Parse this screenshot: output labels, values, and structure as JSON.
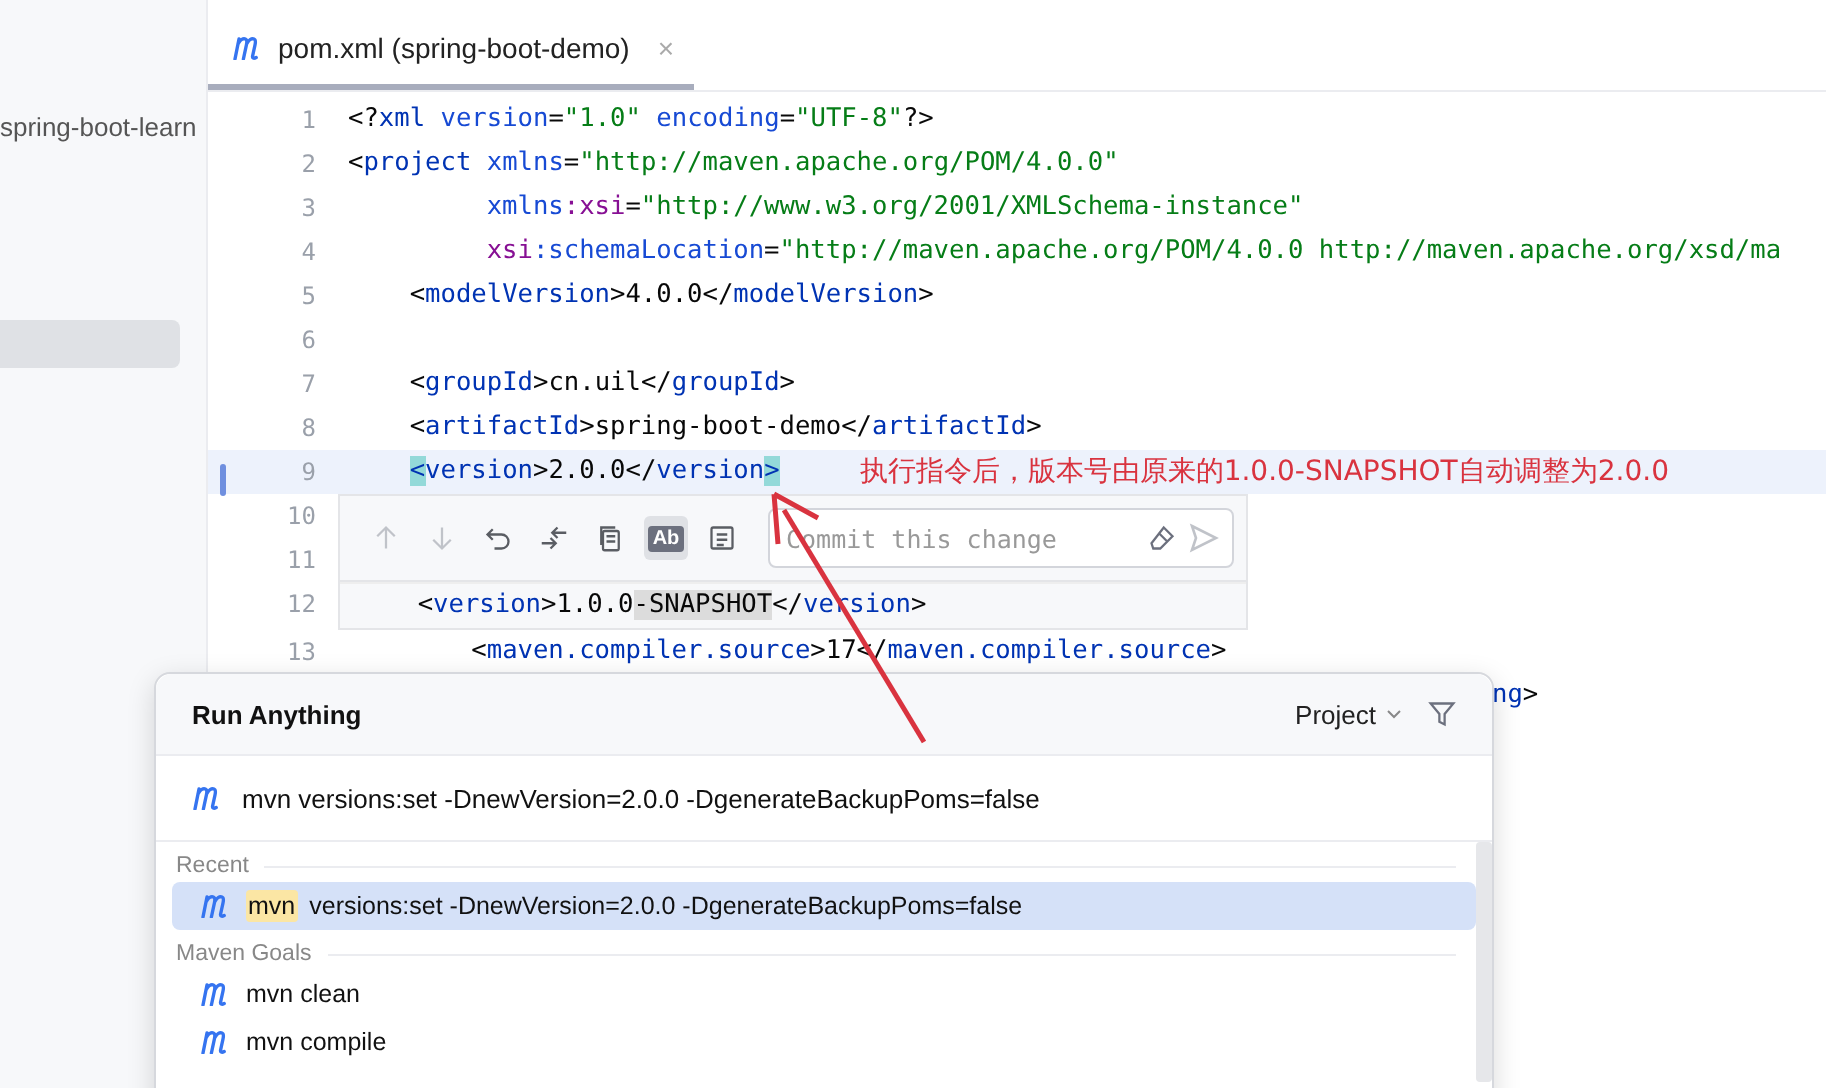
{
  "sidebar": {
    "items": [
      {
        "label": "spring-boot-learn",
        "selected": false
      },
      {
        "selected": true
      }
    ]
  },
  "editor": {
    "tab": {
      "label": "pom.xml (spring-boot-demo)",
      "close": "×",
      "selected": true
    },
    "lines": [
      {
        "kind": "code",
        "number": "1",
        "current": false,
        "changed": false,
        "tokens": [
          {
            "text": "<?",
            "kind": "p"
          },
          {
            "text": "xml",
            "kind": "tag"
          },
          {
            "text": " version",
            "kind": "attr"
          },
          {
            "text": "=",
            "kind": "p"
          },
          {
            "text": "\"1.0\"",
            "kind": "str"
          },
          {
            "text": " encoding",
            "kind": "attr"
          },
          {
            "text": "=",
            "kind": "p"
          },
          {
            "text": "\"UTF-8\"",
            "kind": "str"
          },
          {
            "text": "?>",
            "kind": "p"
          }
        ]
      },
      {
        "kind": "code",
        "number": "2",
        "current": false,
        "changed": false,
        "tokens": [
          {
            "text": "<",
            "kind": "p"
          },
          {
            "text": "project",
            "kind": "tag"
          },
          {
            "text": " xmlns",
            "kind": "attr"
          },
          {
            "text": "=",
            "kind": "p"
          },
          {
            "text": "\"http://maven.apache.org/POM/4.0.0\"",
            "kind": "str"
          }
        ]
      },
      {
        "kind": "code",
        "number": "3",
        "current": false,
        "changed": false,
        "tokens": [
          {
            "text": "         xmlns",
            "kind": "attr"
          },
          {
            "text": ":xsi",
            "kind": "ns"
          },
          {
            "text": "=",
            "kind": "p"
          },
          {
            "text": "\"http://www.w3.org/2001/XMLSchema-instance\"",
            "kind": "str"
          }
        ]
      },
      {
        "kind": "code",
        "number": "4",
        "current": false,
        "changed": false,
        "tokens": [
          {
            "text": "         xsi",
            "kind": "ns"
          },
          {
            "text": ":schemaLocation",
            "kind": "attr"
          },
          {
            "text": "=",
            "kind": "p"
          },
          {
            "text": "\"http://maven.apache.org/POM/4.0.0 http://maven.apache.org/xsd/ma",
            "kind": "str"
          }
        ]
      },
      {
        "kind": "code",
        "number": "5",
        "current": false,
        "changed": false,
        "tokens": [
          {
            "text": "    <",
            "kind": "p"
          },
          {
            "text": "modelVersion",
            "kind": "tag"
          },
          {
            "text": ">",
            "kind": "p"
          },
          {
            "text": "4.0.0",
            "kind": "text"
          },
          {
            "text": "</",
            "kind": "p"
          },
          {
            "text": "modelVersion",
            "kind": "tag"
          },
          {
            "text": ">",
            "kind": "p"
          }
        ]
      },
      {
        "kind": "code",
        "number": "6",
        "current": false,
        "changed": false
      },
      {
        "kind": "code",
        "number": "7",
        "current": false,
        "changed": false,
        "tokens": [
          {
            "text": "    <",
            "kind": "p"
          },
          {
            "text": "groupId",
            "kind": "tag"
          },
          {
            "text": ">",
            "kind": "p"
          },
          {
            "text": "cn.uil",
            "kind": "text"
          },
          {
            "text": "</",
            "kind": "p"
          },
          {
            "text": "groupId",
            "kind": "tag"
          },
          {
            "text": ">",
            "kind": "p"
          }
        ]
      },
      {
        "kind": "code",
        "number": "8",
        "current": false,
        "changed": false,
        "tokens": [
          {
            "text": "    <",
            "kind": "p"
          },
          {
            "text": "artifactId",
            "kind": "tag"
          },
          {
            "text": ">",
            "kind": "p"
          },
          {
            "text": "spring-boot-demo",
            "kind": "text"
          },
          {
            "text": "</",
            "kind": "p"
          },
          {
            "text": "artifactId",
            "kind": "tag"
          },
          {
            "text": ">",
            "kind": "p"
          }
        ]
      },
      {
        "kind": "code",
        "number": "9",
        "current": true,
        "changed": true,
        "note": "执行指令后，版本号由原来的1.0.0-SNAPSHOT自动调整为2.0.0",
        "tokens": [
          {
            "text": "    <",
            "kind": "match"
          },
          {
            "text": "version",
            "kind": "tag"
          },
          {
            "text": ">",
            "kind": "p"
          },
          {
            "text": "2.0.0",
            "kind": "text"
          },
          {
            "text": "</",
            "kind": "p"
          },
          {
            "text": "version",
            "kind": "tag"
          },
          {
            "text": ">",
            "kind": "match"
          }
        ]
      },
      {
        "kind": "inline_diff",
        "numbers": [
          "10",
          "11",
          "12"
        ],
        "commit_placeholder": "Commit this change",
        "toolbar": [
          {
            "kind": "up",
            "disabled": true,
            "selected": false
          },
          {
            "kind": "down",
            "disabled": true,
            "selected": false
          },
          {
            "kind": "undo",
            "disabled": false,
            "selected": false
          },
          {
            "kind": "compare",
            "disabled": false,
            "selected": false
          },
          {
            "kind": "copy",
            "disabled": false,
            "selected": false
          },
          {
            "kind": "case",
            "label": "Ab",
            "disabled": false,
            "selected": true
          },
          {
            "kind": "format",
            "disabled": false,
            "selected": false
          }
        ],
        "old_tokens": [
          {
            "text": "    <",
            "kind": "p"
          },
          {
            "text": "version",
            "kind": "tag"
          },
          {
            "text": ">",
            "kind": "p"
          },
          {
            "text": "1.0.0",
            "kind": "text"
          },
          {
            "text": "-SNAPSHOT",
            "kind": "removed"
          },
          {
            "text": "</",
            "kind": "p"
          },
          {
            "text": "version",
            "kind": "tag"
          },
          {
            "text": ">",
            "kind": "p"
          }
        ]
      },
      {
        "kind": "code",
        "number": "13",
        "current": false,
        "changed": false,
        "tokens": [
          {
            "text": "        <",
            "kind": "p"
          },
          {
            "text": "maven.compiler.source",
            "kind": "tag"
          },
          {
            "text": ">",
            "kind": "p"
          },
          {
            "text": "17",
            "kind": "text"
          },
          {
            "text": "</",
            "kind": "p"
          },
          {
            "text": "maven.compiler.source",
            "kind": "tag"
          },
          {
            "text": ">",
            "kind": "p"
          }
        ]
      },
      {
        "kind": "tail",
        "tokens": [
          {
            "text": "ng",
            "kind": "tag"
          },
          {
            "text": ">",
            "kind": "p"
          }
        ]
      }
    ]
  },
  "run_anything": {
    "title": "Run Anything",
    "scope": "Project",
    "command": "mvn versions:set -DnewVersion=2.0.0 -DgenerateBackupPoms=false",
    "sections": [
      {
        "title": "Recent",
        "items": [
          {
            "match": "mvn",
            "text": "versions:set -DnewVersion=2.0.0 -DgenerateBackupPoms=false",
            "selected": true
          }
        ]
      },
      {
        "title": "Maven Goals",
        "items": [
          {
            "text": "mvn clean",
            "selected": false
          },
          {
            "text": "mvn compile",
            "selected": false
          }
        ]
      }
    ]
  }
}
